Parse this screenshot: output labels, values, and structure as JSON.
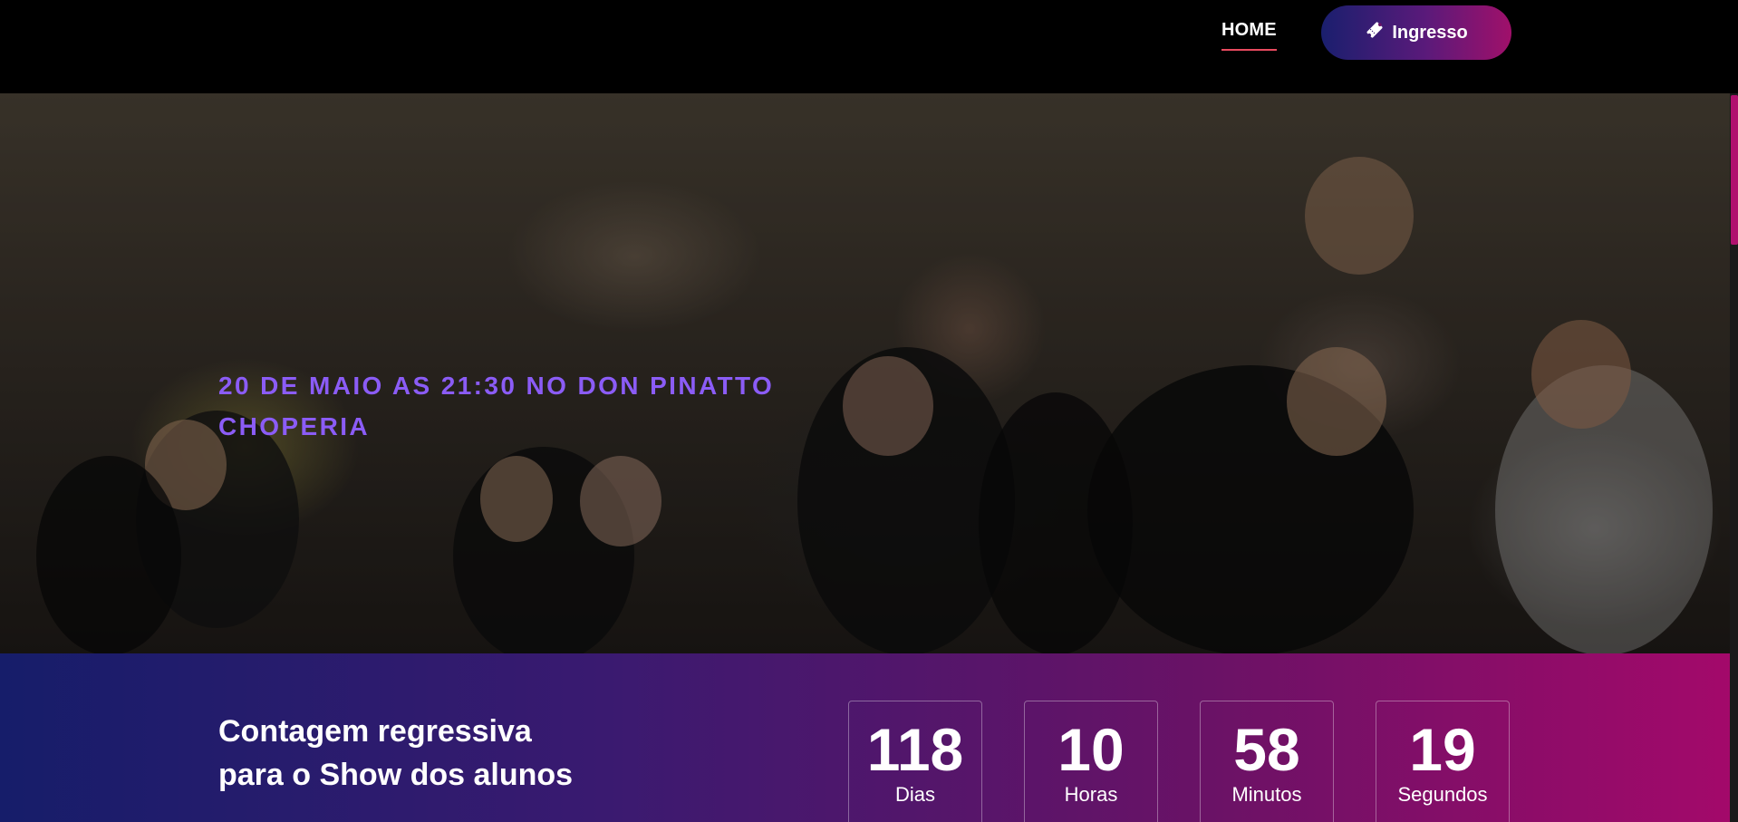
{
  "header": {
    "nav": {
      "home_label": "HOME"
    },
    "ticket_button": {
      "label": "Ingresso",
      "icon": "ticket-icon"
    }
  },
  "hero": {
    "title": "20 DE MAIO AS 21:30 NO DON PINATTO CHOPERIA",
    "image_description_icon": "crowd-photo"
  },
  "countdown": {
    "heading": "Contagem regressiva para o Show dos alunos",
    "units": [
      {
        "value": "118",
        "label": "Dias"
      },
      {
        "value": "10",
        "label": "Horas"
      },
      {
        "value": "58",
        "label": "Minutos"
      },
      {
        "value": "19",
        "label": "Segundos"
      }
    ]
  },
  "colors": {
    "accent_purple": "#8b5cf6",
    "nav_underline": "#e84a5f",
    "gradient_start": "#161d6a",
    "gradient_end": "#a3096a"
  }
}
